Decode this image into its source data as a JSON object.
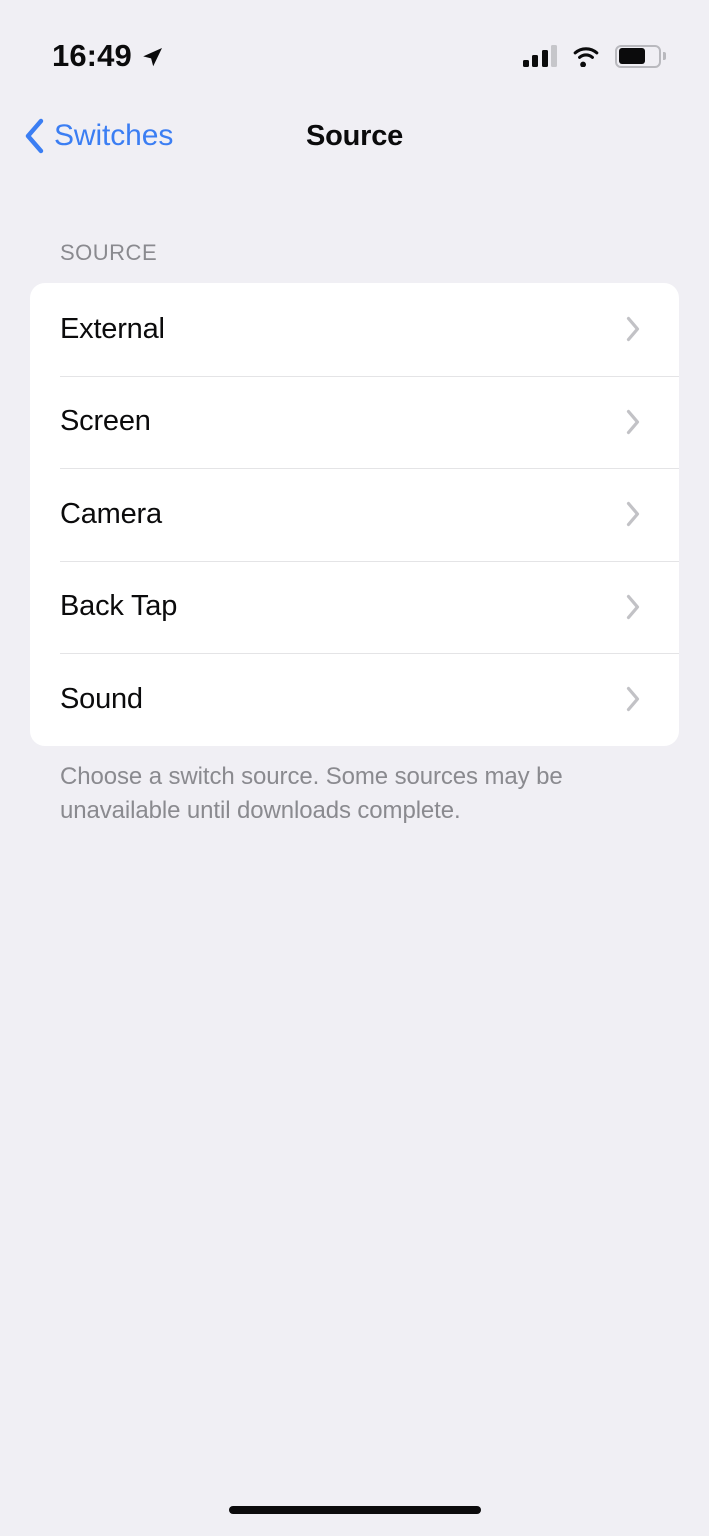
{
  "status_bar": {
    "time": "16:49",
    "location_icon": "location-arrow-icon",
    "cellular_icon": "cellular-signal-icon",
    "cellular_bars_filled": 3,
    "cellular_bars_total": 4,
    "wifi_icon": "wifi-icon",
    "battery_icon": "battery-icon",
    "battery_level_percent": 65
  },
  "nav": {
    "back_label": "Switches",
    "back_icon": "chevron-left-icon",
    "title": "Source"
  },
  "section": {
    "header": "SOURCE",
    "rows": [
      {
        "label": "External",
        "chevron": "chevron-right-icon"
      },
      {
        "label": "Screen",
        "chevron": "chevron-right-icon"
      },
      {
        "label": "Camera",
        "chevron": "chevron-right-icon"
      },
      {
        "label": "Back Tap",
        "chevron": "chevron-right-icon"
      },
      {
        "label": "Sound",
        "chevron": "chevron-right-icon"
      }
    ],
    "footer": "Choose a switch source. Some sources may be unavailable until downloads complete."
  },
  "colors": {
    "background": "#f0eff4",
    "card": "#ffffff",
    "accent_blue": "#3b7ef3",
    "secondary_text": "#8a8a8f",
    "primary_text": "#0b0b0c",
    "separator": "#e4e4e6",
    "chevron_gray": "#c2c2c6"
  },
  "home_indicator": "home-indicator"
}
